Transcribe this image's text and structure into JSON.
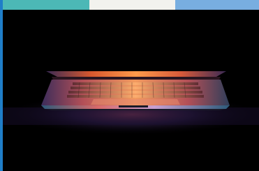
{
  "top_bar": {
    "segments": [
      {
        "color": "#4cb8b6"
      },
      {
        "color": "#f2f2ee"
      },
      {
        "color": "#78aee0"
      }
    ]
  },
  "left_strip": {
    "color": "#1f7ec8"
  },
  "photo": {
    "subject_icon": "laptop-icon"
  }
}
